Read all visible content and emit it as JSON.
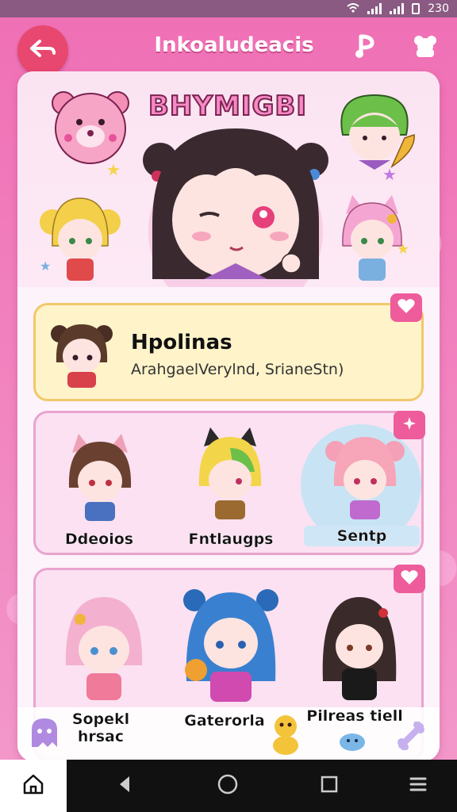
{
  "status": {
    "time": "23:0",
    "time_display": "230"
  },
  "header": {
    "title": "Inkoaludeacis",
    "back_icon": "back-arrow-icon",
    "right_icons": [
      "music-note-icon",
      "plushie-icon"
    ]
  },
  "hero": {
    "title": "BHYMIGBI"
  },
  "profile": {
    "name": "Hpolinas",
    "subtitle": "ArahgaelVerylnd, SrianeStn)",
    "heart_icon": "heart-icon"
  },
  "grid1": {
    "badge_icon": "sparkle-icon",
    "characters": [
      {
        "label": "Ddeoios"
      },
      {
        "label": "Fntlaugps"
      },
      {
        "label": "Sentp"
      }
    ]
  },
  "grid2": {
    "badge_icon": "heart-icon",
    "characters": [
      {
        "label": "Sopekl hrsac"
      },
      {
        "label": "Gaterorla"
      },
      {
        "label": "Pilreas tiell"
      }
    ]
  },
  "nav": {
    "items": [
      "home-icon",
      "back-triangle-icon",
      "home-circle-icon",
      "recents-square-icon",
      "menu-icon"
    ]
  },
  "colors": {
    "accent": "#ee5c9b",
    "back_button": "#e8476f",
    "profile_bg": "#fff3c9"
  }
}
